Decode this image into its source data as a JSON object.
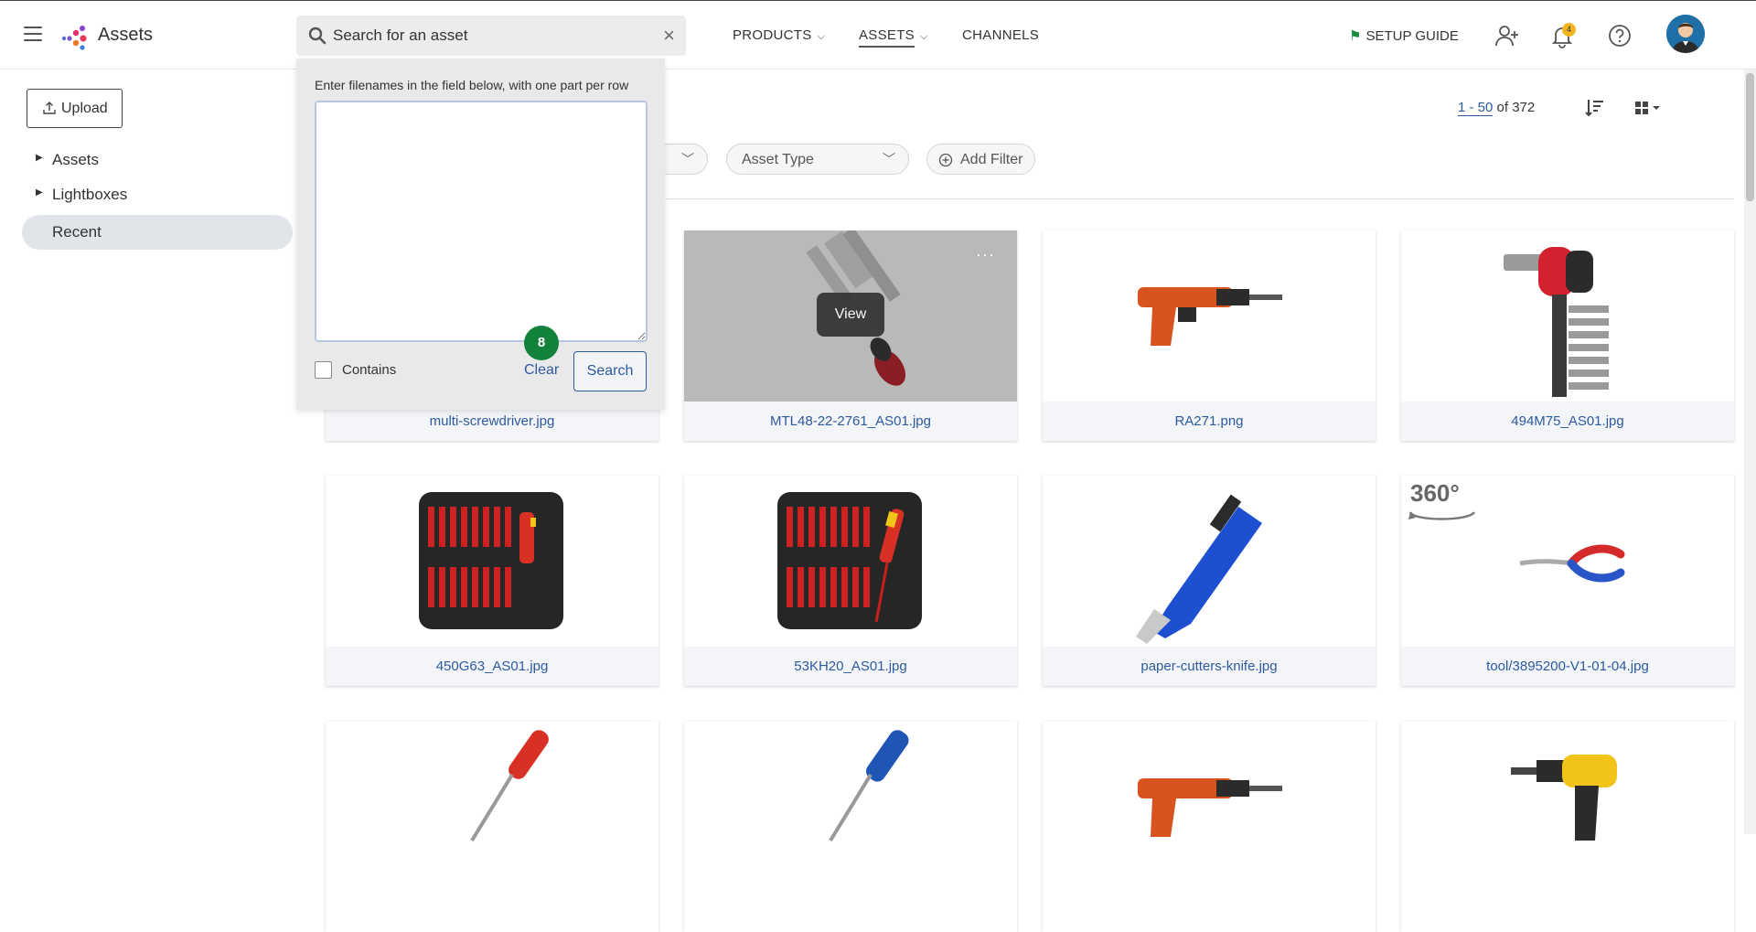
{
  "header": {
    "app_title": "Assets",
    "search_placeholder": "Search for an asset",
    "nav": [
      {
        "label": "PRODUCTS"
      },
      {
        "label": "ASSETS"
      },
      {
        "label": "CHANNELS"
      }
    ],
    "setup_guide": "SETUP GUIDE",
    "notification_count": "4"
  },
  "search_popover": {
    "hint": "Enter filenames in the field below, with one part per row",
    "textarea_value": "",
    "contains_label": "Contains",
    "clear_label": "Clear",
    "search_label": "Search",
    "step_badge": "8"
  },
  "sidebar": {
    "upload_label": "Upload",
    "items": [
      {
        "label": "Assets"
      },
      {
        "label": "Lightboxes"
      },
      {
        "label": "Recent"
      }
    ]
  },
  "toolbar": {
    "range": "1 - 50",
    "total": "of 372",
    "filters": [
      {
        "label": "Asset Type"
      },
      {
        "label": "Add Filter"
      }
    ]
  },
  "assets": [
    {
      "name": "multi-screwdriver.jpg"
    },
    {
      "name": "MTL48-22-2761_AS01.jpg",
      "hover_label": "View"
    },
    {
      "name": "RA271.png"
    },
    {
      "name": "494M75_AS01.jpg"
    },
    {
      "name": "450G63_AS01.jpg"
    },
    {
      "name": "53KH20_AS01.jpg"
    },
    {
      "name": "paper-cutters-knife.jpg"
    },
    {
      "name": "tool/3895200-V1-01-04.jpg",
      "overlay": "360°"
    },
    {
      "name": ""
    },
    {
      "name": ""
    },
    {
      "name": ""
    },
    {
      "name": ""
    }
  ],
  "colors": {
    "accent": "#2c5aa0",
    "badge": "#12823a",
    "notification": "#f2b41f"
  }
}
